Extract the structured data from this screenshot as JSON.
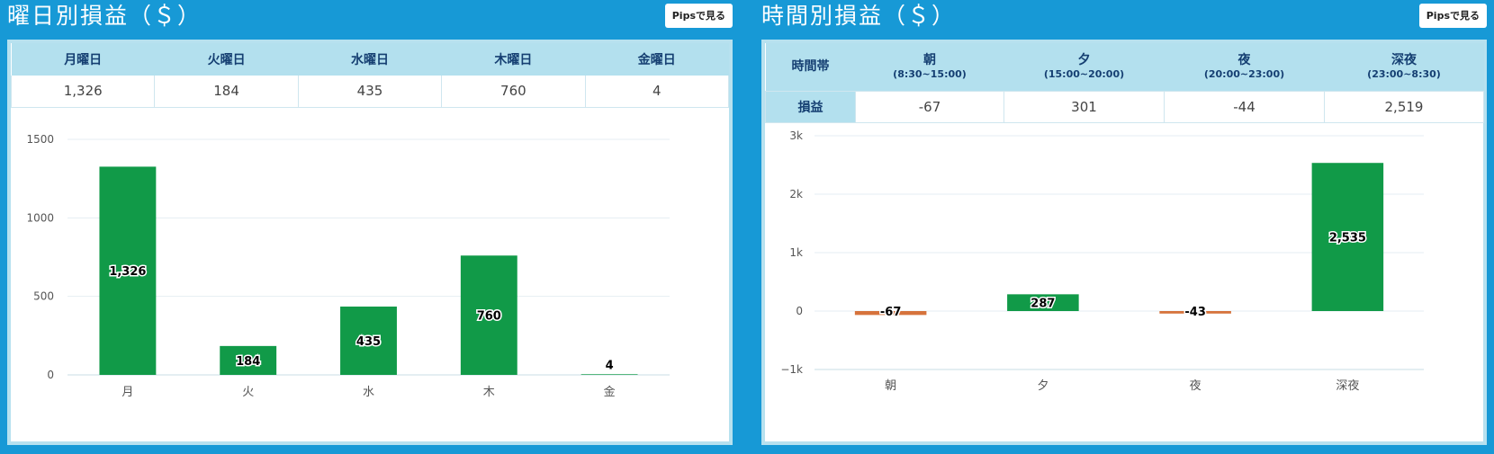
{
  "left": {
    "title": "曜日別損益（＄）",
    "button": "Pipsで見る",
    "table": {
      "headers": [
        "月曜日",
        "火曜日",
        "水曜日",
        "木曜日",
        "金曜日"
      ],
      "values": [
        "1,326",
        "184",
        "435",
        "760",
        "4"
      ]
    }
  },
  "right": {
    "title": "時間別損益（＄）",
    "button": "Pipsで見る",
    "table": {
      "corner": "時間帯",
      "headers": [
        {
          "name": "朝",
          "range": "(8:30~15:00)"
        },
        {
          "name": "夕",
          "range": "(15:00~20:00)"
        },
        {
          "name": "夜",
          "range": "(20:00~23:00)"
        },
        {
          "name": "深夜",
          "range": "(23:00~8:30)"
        }
      ],
      "row_label": "損益",
      "values": [
        "-67",
        "301",
        "-44",
        "2,519"
      ]
    }
  },
  "chart_data": [
    {
      "type": "bar",
      "categories": [
        "月",
        "火",
        "水",
        "木",
        "金"
      ],
      "values": [
        1326,
        184,
        435,
        760,
        4
      ],
      "data_labels": [
        "1,326",
        "184",
        "435",
        "760",
        "4"
      ],
      "ylim": [
        0,
        1500
      ],
      "yticks": [
        0,
        500,
        1000,
        1500
      ],
      "ytick_labels": [
        "0",
        "500",
        "1000",
        "1500"
      ],
      "grid": true,
      "colors": {
        "positive": "#119a48",
        "negative": "#d6733c"
      }
    },
    {
      "type": "bar",
      "categories": [
        "朝",
        "夕",
        "夜",
        "深夜"
      ],
      "values": [
        -67,
        287,
        -43,
        2535
      ],
      "data_labels": [
        "-67",
        "287",
        "-43",
        "2,535"
      ],
      "ylim": [
        -1000,
        3000
      ],
      "yticks": [
        -1000,
        0,
        1000,
        2000,
        3000
      ],
      "ytick_labels": [
        "−1k",
        "0",
        "1k",
        "2k",
        "3k"
      ],
      "grid": true,
      "colors": {
        "positive": "#119a48",
        "negative": "#d6733c"
      }
    }
  ]
}
